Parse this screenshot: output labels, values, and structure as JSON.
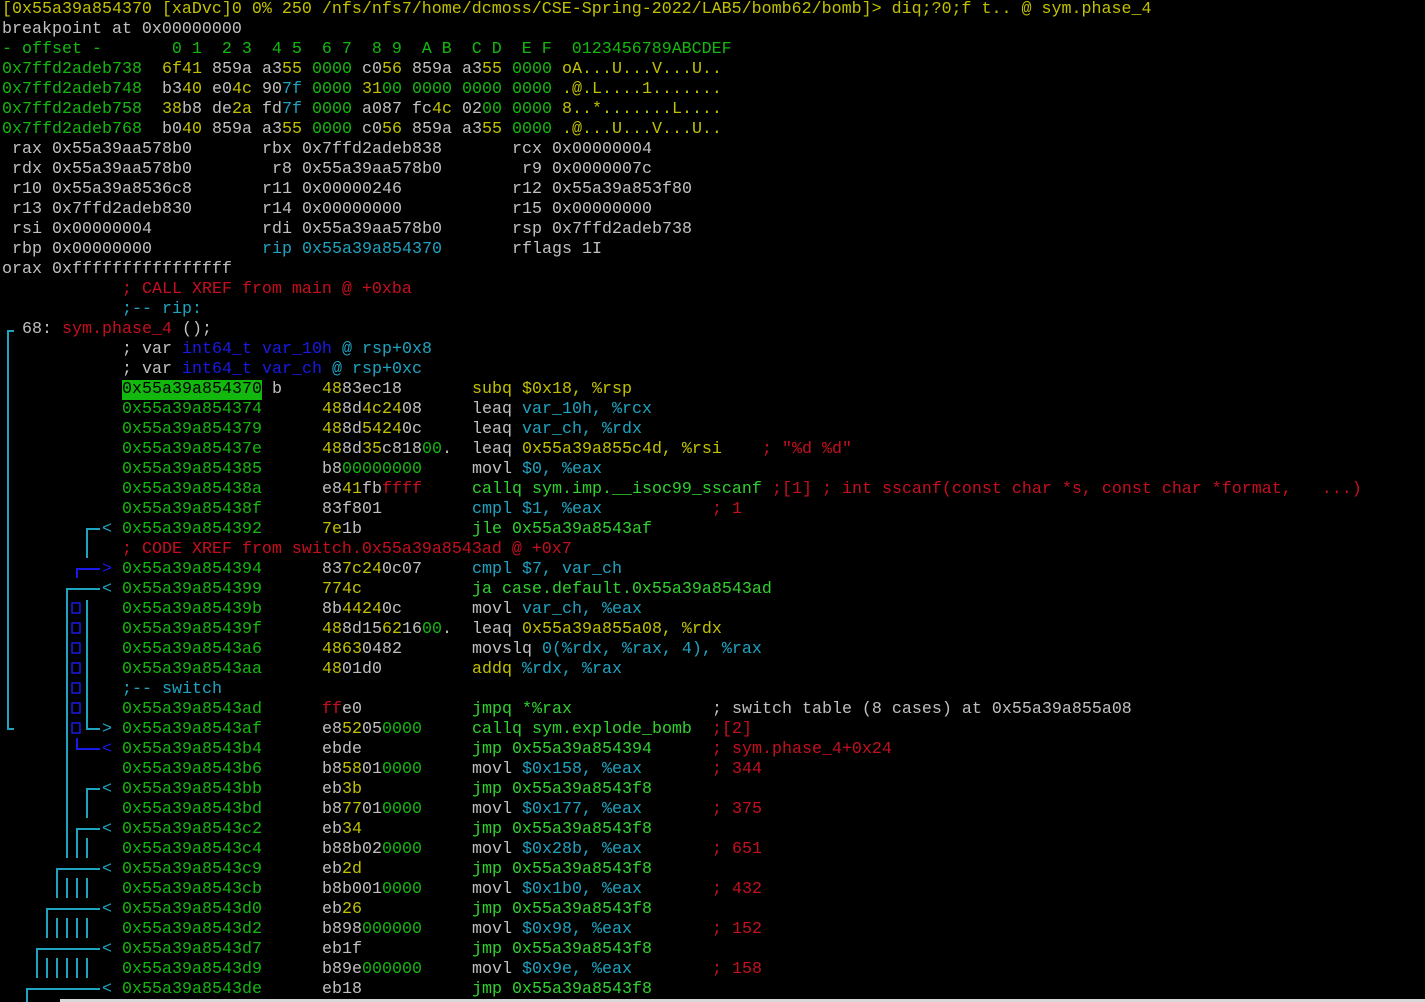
{
  "prompt_line": "[0x55a39a854370 [xaDvc]0 0% 250 /nfs/nfs7/home/dcmoss/CSE-Spring-2022/LAB5/bomb62/bomb]> diq;?0;f t.. @ sym.phase_4",
  "breakpoint_line": "breakpoint at 0x00000000",
  "hexdump": {
    "header": "- offset -       0 1  2 3  4 5  6 7  8 9  A B  C D  E F  0123456789ABCDEF",
    "rows": [
      {
        "offset": "0x7ffd2adeb738",
        "words": [
          "6f41",
          "859a",
          "a355",
          "0000",
          "c056",
          "859a",
          "a355",
          "0000"
        ],
        "ascii": "oA...U...V...U.."
      },
      {
        "offset": "0x7ffd2adeb748",
        "words": [
          "b340",
          "e04c",
          "907f",
          "0000",
          "3100",
          "0000",
          "0000",
          "0000"
        ],
        "ascii": ".@.L....1......."
      },
      {
        "offset": "0x7ffd2adeb758",
        "words": [
          "38b8",
          "de2a",
          "fd7f",
          "0000",
          "a087",
          "fc4c",
          "0200",
          "0000"
        ],
        "ascii": "8..*.......L...."
      },
      {
        "offset": "0x7ffd2adeb768",
        "words": [
          "b040",
          "859a",
          "a355",
          "0000",
          "c056",
          "859a",
          "a355",
          "0000"
        ],
        "ascii": ".@...U...V...U.."
      }
    ]
  },
  "registers": [
    [
      {
        "name": "rax",
        "value": "0x55a39aa578b0"
      },
      {
        "name": "rbx",
        "value": "0x7ffd2adeb838"
      },
      {
        "name": "rcx",
        "value": "0x00000004"
      }
    ],
    [
      {
        "name": "rdx",
        "value": "0x55a39aa578b0"
      },
      {
        "name": "r8",
        "value": "0x55a39aa578b0"
      },
      {
        "name": "r9",
        "value": "0x0000007c"
      }
    ],
    [
      {
        "name": "r10",
        "value": "0x55a39a8536c8"
      },
      {
        "name": "r11",
        "value": "0x00000246"
      },
      {
        "name": "r12",
        "value": "0x55a39a853f80"
      }
    ],
    [
      {
        "name": "r13",
        "value": "0x7ffd2adeb830"
      },
      {
        "name": "r14",
        "value": "0x00000000"
      },
      {
        "name": "r15",
        "value": "0x00000000"
      }
    ],
    [
      {
        "name": "rsi",
        "value": "0x00000004"
      },
      {
        "name": "rdi",
        "value": "0x55a39aa578b0"
      },
      {
        "name": "rsp",
        "value": "0x7ffd2adeb738"
      }
    ],
    [
      {
        "name": "rbp",
        "value": "0x00000000"
      },
      {
        "name": "rip",
        "value": "0x55a39a854370",
        "highlight": true
      },
      {
        "name": "rflags",
        "value": "1I"
      }
    ]
  ],
  "orax": {
    "name": "orax",
    "value": "0xffffffffffffffff"
  },
  "disasm": [
    {
      "t": "xref",
      "text": "; CALL XREF from main @ +0xba"
    },
    {
      "t": "flag",
      "text": ";-- rip:"
    },
    {
      "t": "func",
      "num": "68:",
      "name": "sym.phase_4",
      "rest": " ();"
    },
    {
      "t": "var",
      "pre": "; var ",
      "type": "int64_t var_10h",
      "at": " @ ",
      "loc": "rsp+0x8"
    },
    {
      "t": "var",
      "pre": "; var ",
      "type": "int64_t var_ch",
      "at": " @ ",
      "loc": "rsp+0xc"
    },
    {
      "t": "ins",
      "addr": "0x55a39a854370",
      "current": true,
      "flag": "b",
      "bytes": "4883ec18",
      "mn": "subq",
      "args": "$0x18, %rsp",
      "cmt": ""
    },
    {
      "t": "ins",
      "addr": "0x55a39a854374",
      "bytes": "488d4c2408",
      "mn": "leaq",
      "args": "var_10h, %rcx",
      "cmt": ""
    },
    {
      "t": "ins",
      "addr": "0x55a39a854379",
      "bytes": "488d54240c",
      "mn": "leaq",
      "args": "var_ch, %rdx",
      "cmt": ""
    },
    {
      "t": "ins",
      "addr": "0x55a39a85437e",
      "bytes": "488d35c81800.",
      "mn": "leaq",
      "args": "0x55a39a855c4d, %rsi",
      "cmt": "; \"%d %d\"",
      "gap": "    "
    },
    {
      "t": "ins",
      "addr": "0x55a39a854385",
      "bytes": "b800000000",
      "mn": "movl",
      "args": "$0, %eax",
      "cmt": ""
    },
    {
      "t": "ins",
      "addr": "0x55a39a85438a",
      "bytes": "e841fbffff",
      "mn": "callq",
      "args": "sym.imp.__isoc99_sscanf",
      "cmt": ";[1] ; int sscanf(const char *s, const char *format,   ...)",
      "gap": " "
    },
    {
      "t": "ins",
      "addr": "0x55a39a85438f",
      "bytes": "83f801",
      "mn": "cmpl",
      "args": "$1, %eax",
      "cmt": "; 1"
    },
    {
      "t": "ins",
      "addr": "0x55a39a854392",
      "arrow": "<",
      "bytes": "7e1b",
      "mn": "jle",
      "args": "0x55a39a8543af",
      "cmt": ""
    },
    {
      "t": "xref",
      "text": "; CODE XREF from switch.0x55a39a8543ad @ +0x7"
    },
    {
      "t": "ins",
      "addr": "0x55a39a854394",
      "arrow": ">",
      "arrow_blue": true,
      "bytes": "837c240c07",
      "mn": "cmpl",
      "args": "$7, var_ch",
      "cmt": ""
    },
    {
      "t": "ins",
      "addr": "0x55a39a854399",
      "arrow": "<",
      "bytes": "774c",
      "mn": "ja",
      "args": "case.default.0x55a39a8543ad",
      "cmt": ""
    },
    {
      "t": "ins",
      "addr": "0x55a39a85439b",
      "bytes": "8b44240c",
      "mn": "movl",
      "args": "var_ch, %eax",
      "cmt": ""
    },
    {
      "t": "ins",
      "addr": "0x55a39a85439f",
      "bytes": "488d15621600.",
      "mn": "leaq",
      "args": "0x55a39a855a08, %rdx",
      "cmt": ""
    },
    {
      "t": "ins",
      "addr": "0x55a39a8543a6",
      "bytes": "48630482",
      "mn": "movslq",
      "args": "0(%rdx, %rax, 4), %rax",
      "cmt": ""
    },
    {
      "t": "ins",
      "addr": "0x55a39a8543aa",
      "bytes": "4801d0",
      "mn": "addq",
      "args": "%rdx, %rax",
      "cmt": ""
    },
    {
      "t": "flag",
      "text": ";-- switch"
    },
    {
      "t": "ins",
      "addr": "0x55a39a8543ad",
      "bytes": "ffe0",
      "mn": "jmpq",
      "args": "*%rax",
      "cmt": "; switch table (8 cases) at 0x55a39a855a08",
      "cmt_white": true
    },
    {
      "t": "ins",
      "addr": "0x55a39a8543af",
      "arrow": ">",
      "bytes": "e852050000",
      "mn": "callq",
      "args": "sym.explode_bomb",
      "cmt": ";[2]"
    },
    {
      "t": "ins",
      "addr": "0x55a39a8543b4",
      "arrow": "<",
      "arrow_blue": true,
      "bytes": "ebde",
      "mn": "jmp",
      "args": "0x55a39a854394",
      "cmt": "; sym.phase_4+0x24"
    },
    {
      "t": "ins",
      "addr": "0x55a39a8543b6",
      "bytes": "b858010000",
      "mn": "movl",
      "args": "$0x158, %eax",
      "cmt": "; 344"
    },
    {
      "t": "ins",
      "addr": "0x55a39a8543bb",
      "arrow": "<",
      "bytes": "eb3b",
      "mn": "jmp",
      "args": "0x55a39a8543f8",
      "cmt": ""
    },
    {
      "t": "ins",
      "addr": "0x55a39a8543bd",
      "bytes": "b877010000",
      "mn": "movl",
      "args": "$0x177, %eax",
      "cmt": "; 375"
    },
    {
      "t": "ins",
      "addr": "0x55a39a8543c2",
      "arrow": "<",
      "bytes": "eb34",
      "mn": "jmp",
      "args": "0x55a39a8543f8",
      "cmt": ""
    },
    {
      "t": "ins",
      "addr": "0x55a39a8543c4",
      "bytes": "b88b020000",
      "mn": "movl",
      "args": "$0x28b, %eax",
      "cmt": "; 651"
    },
    {
      "t": "ins",
      "addr": "0x55a39a8543c9",
      "arrow": "<",
      "bytes": "eb2d",
      "mn": "jmp",
      "args": "0x55a39a8543f8",
      "cmt": ""
    },
    {
      "t": "ins",
      "addr": "0x55a39a8543cb",
      "bytes": "b8b0010000",
      "mn": "movl",
      "args": "$0x1b0, %eax",
      "cmt": "; 432"
    },
    {
      "t": "ins",
      "addr": "0x55a39a8543d0",
      "arrow": "<",
      "bytes": "eb26",
      "mn": "jmp",
      "args": "0x55a39a8543f8",
      "cmt": ""
    },
    {
      "t": "ins",
      "addr": "0x55a39a8543d2",
      "bytes": "b898000000",
      "mn": "movl",
      "args": "$0x98, %eax",
      "cmt": "; 152"
    },
    {
      "t": "ins",
      "addr": "0x55a39a8543d7",
      "arrow": "<",
      "bytes": "eb1f",
      "mn": "jmp",
      "args": "0x55a39a8543f8",
      "cmt": ""
    },
    {
      "t": "ins",
      "addr": "0x55a39a8543d9",
      "bytes": "b89e000000",
      "mn": "movl",
      "args": "$0x9e, %eax",
      "cmt": "; 158"
    },
    {
      "t": "ins",
      "addr": "0x55a39a8543de",
      "arrow": "<",
      "bytes": "eb18",
      "mn": "jmp",
      "args": "0x55a39a8543f8",
      "cmt": ""
    }
  ],
  "colors": {
    "yellow": "#c1c100",
    "green": "#13b80e",
    "white": "#c0c0c0",
    "cyan": "#1fa3c0",
    "red": "#c50f1f",
    "blue": "#1a1ae6"
  }
}
